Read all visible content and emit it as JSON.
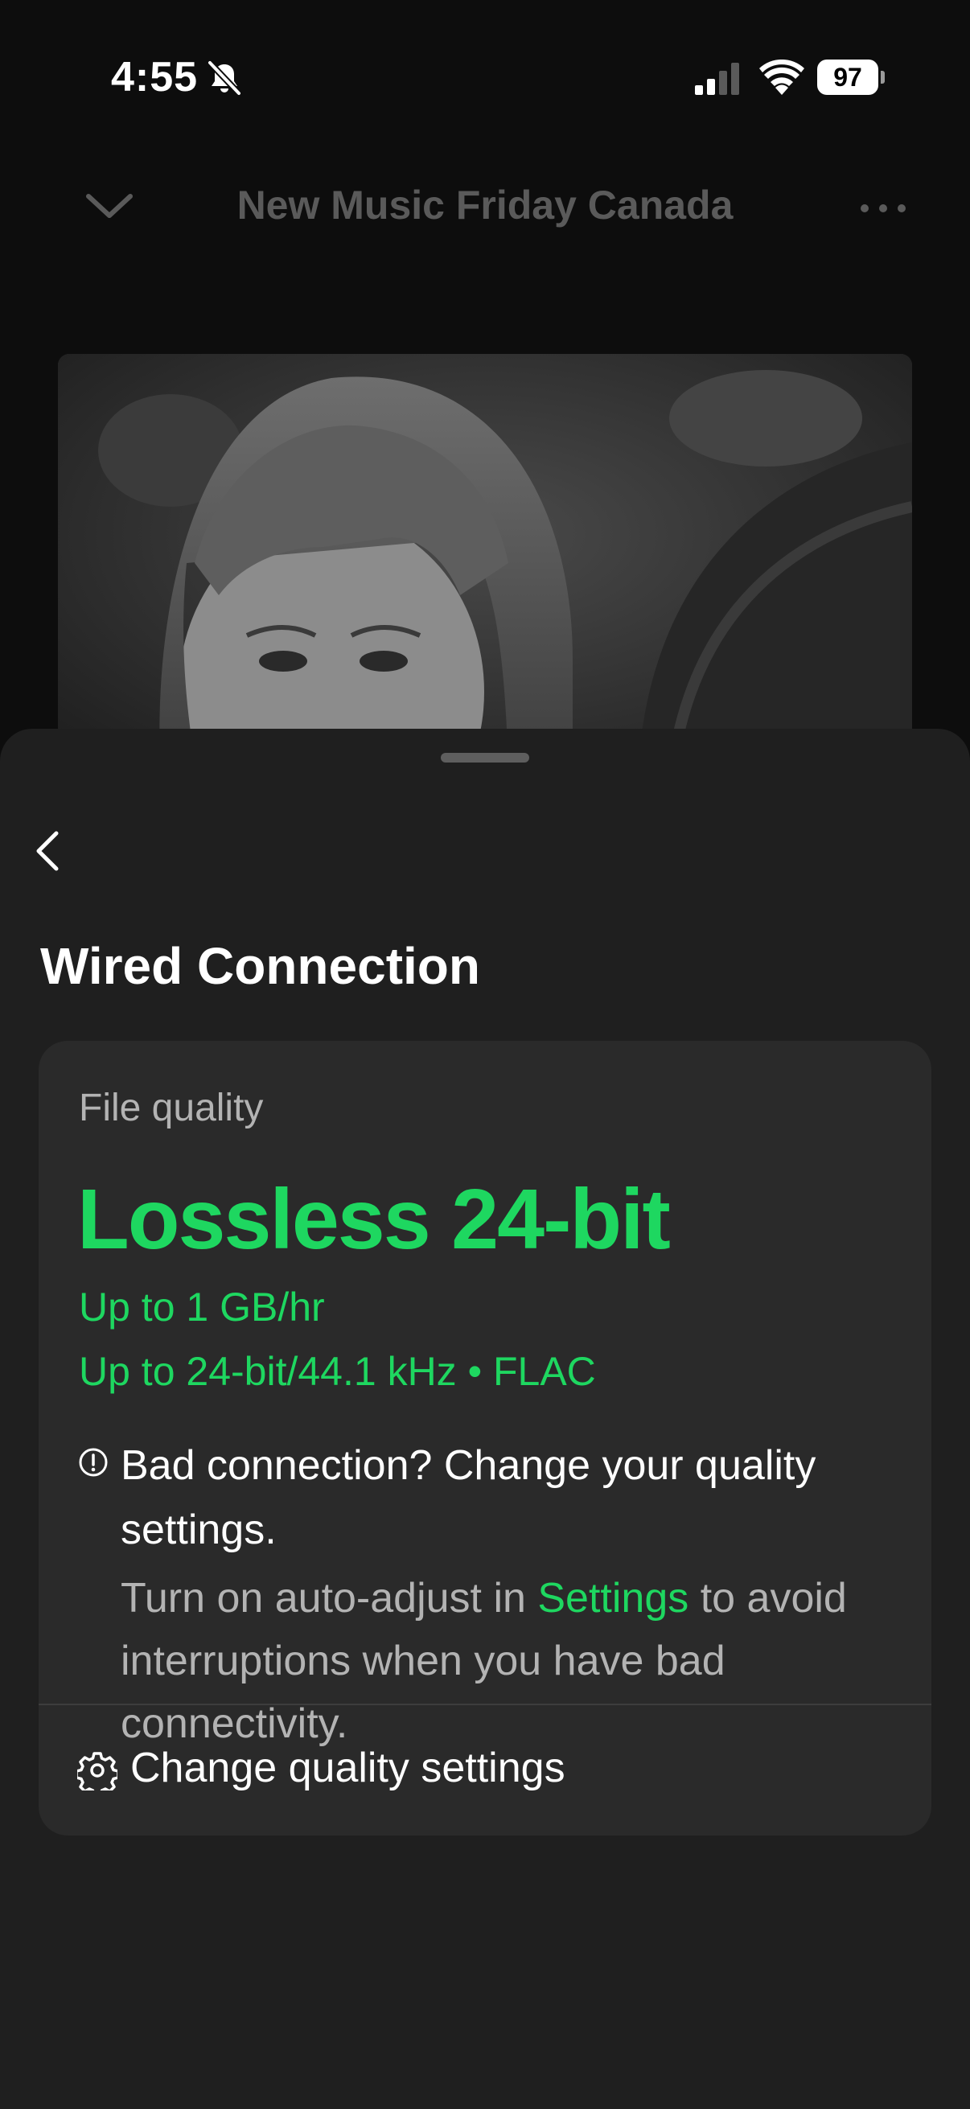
{
  "status_bar": {
    "time": "4:55",
    "battery_level": "97",
    "icons": [
      "bell-slash-icon",
      "cellular-signal-icon",
      "wifi-icon",
      "battery-icon"
    ]
  },
  "player_header": {
    "title": "New Music Friday Canada",
    "left_icon": "chevron-down-icon",
    "right_icon": "more-icon"
  },
  "album_art": {
    "icon": "album-cover-image"
  },
  "sheet": {
    "back_icon": "chevron-left-icon",
    "title": "Wired Connection",
    "card": {
      "label": "File quality",
      "quality_name": "Lossless 24-bit",
      "quality_lines": [
        "Up to 1 GB/hr",
        "Up to 24-bit/44.1 kHz • FLAC"
      ],
      "warning": {
        "icon": "exclamation-circle-icon",
        "title": "Bad connection? Change your quality settings.",
        "body_before": "Turn on auto-adjust in ",
        "link": "Settings",
        "body_after": " to avoid interruptions when you have bad connectivity."
      },
      "action": {
        "icon": "gear-icon",
        "label": "Change quality settings"
      }
    }
  },
  "colors": {
    "accent": "#1ed760",
    "sheet_bg": "#1f1f1f",
    "card_bg": "#2a2a2a",
    "muted_text": "#b3b3b3"
  }
}
